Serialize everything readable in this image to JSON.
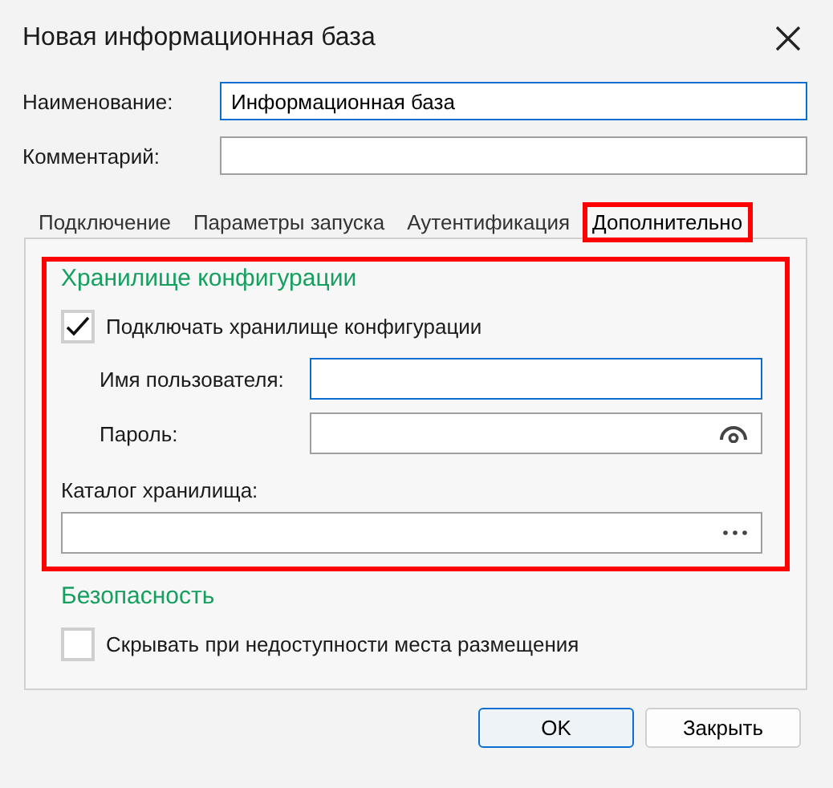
{
  "window": {
    "title": "Новая информационная база"
  },
  "fields": [
    {
      "label": "Наименование:",
      "value": "Информационная база"
    },
    {
      "label": "Комментарий:"
    }
  ],
  "tabs": [
    {
      "label": "Подключение",
      "selected": false,
      "highlighted": false
    },
    {
      "label": "Параметры запуска",
      "selected": false,
      "highlighted": false
    },
    {
      "label": "Аутентификация",
      "selected": false,
      "highlighted": false
    },
    {
      "label": "Дополнительно",
      "selected": true,
      "highlighted": true
    }
  ],
  "sections": [
    {
      "title": "Хранилище конфигурации",
      "highlighted": true,
      "items": [
        {
          "kind": "checkbox",
          "label": "Подключать хранилище конфигурации",
          "checked": true
        },
        {
          "kind": "field",
          "label": "Имя пользователя:",
          "focused": true
        },
        {
          "kind": "password",
          "label": "Пароль:",
          "focused": false
        },
        {
          "kind": "browse",
          "label": "Каталог хранилища:",
          "focused": false
        }
      ]
    },
    {
      "title": "Безопасность",
      "highlighted": false,
      "items": [
        {
          "kind": "checkbox",
          "label": "Скрывать при недоступности места размещения",
          "checked": false
        }
      ]
    }
  ],
  "buttons": [
    {
      "label": "OK",
      "default": true
    },
    {
      "label": "Закрыть",
      "default": false
    }
  ]
}
